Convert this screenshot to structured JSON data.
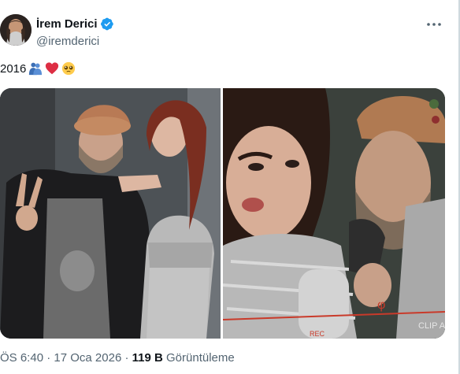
{
  "author": {
    "display_name": "İrem Derici",
    "handle": "@iremderici",
    "verified": true
  },
  "tweet": {
    "text": "2016",
    "emojis": [
      "hugging-people-emoji",
      "red-heart-emoji",
      "pleading-face-emoji"
    ]
  },
  "media": {
    "photos": [
      {
        "description": "photo-left"
      },
      {
        "description": "photo-right",
        "overlay_text": "CLIP A"
      }
    ]
  },
  "meta": {
    "time": "ÖS 6:40",
    "separator": " · ",
    "date": "17 Oca 2026",
    "views_count": "119 B",
    "views_label": "Görüntüleme"
  },
  "colors": {
    "text_primary": "#0f1419",
    "text_secondary": "#536471",
    "verified_blue": "#1d9bf0"
  }
}
